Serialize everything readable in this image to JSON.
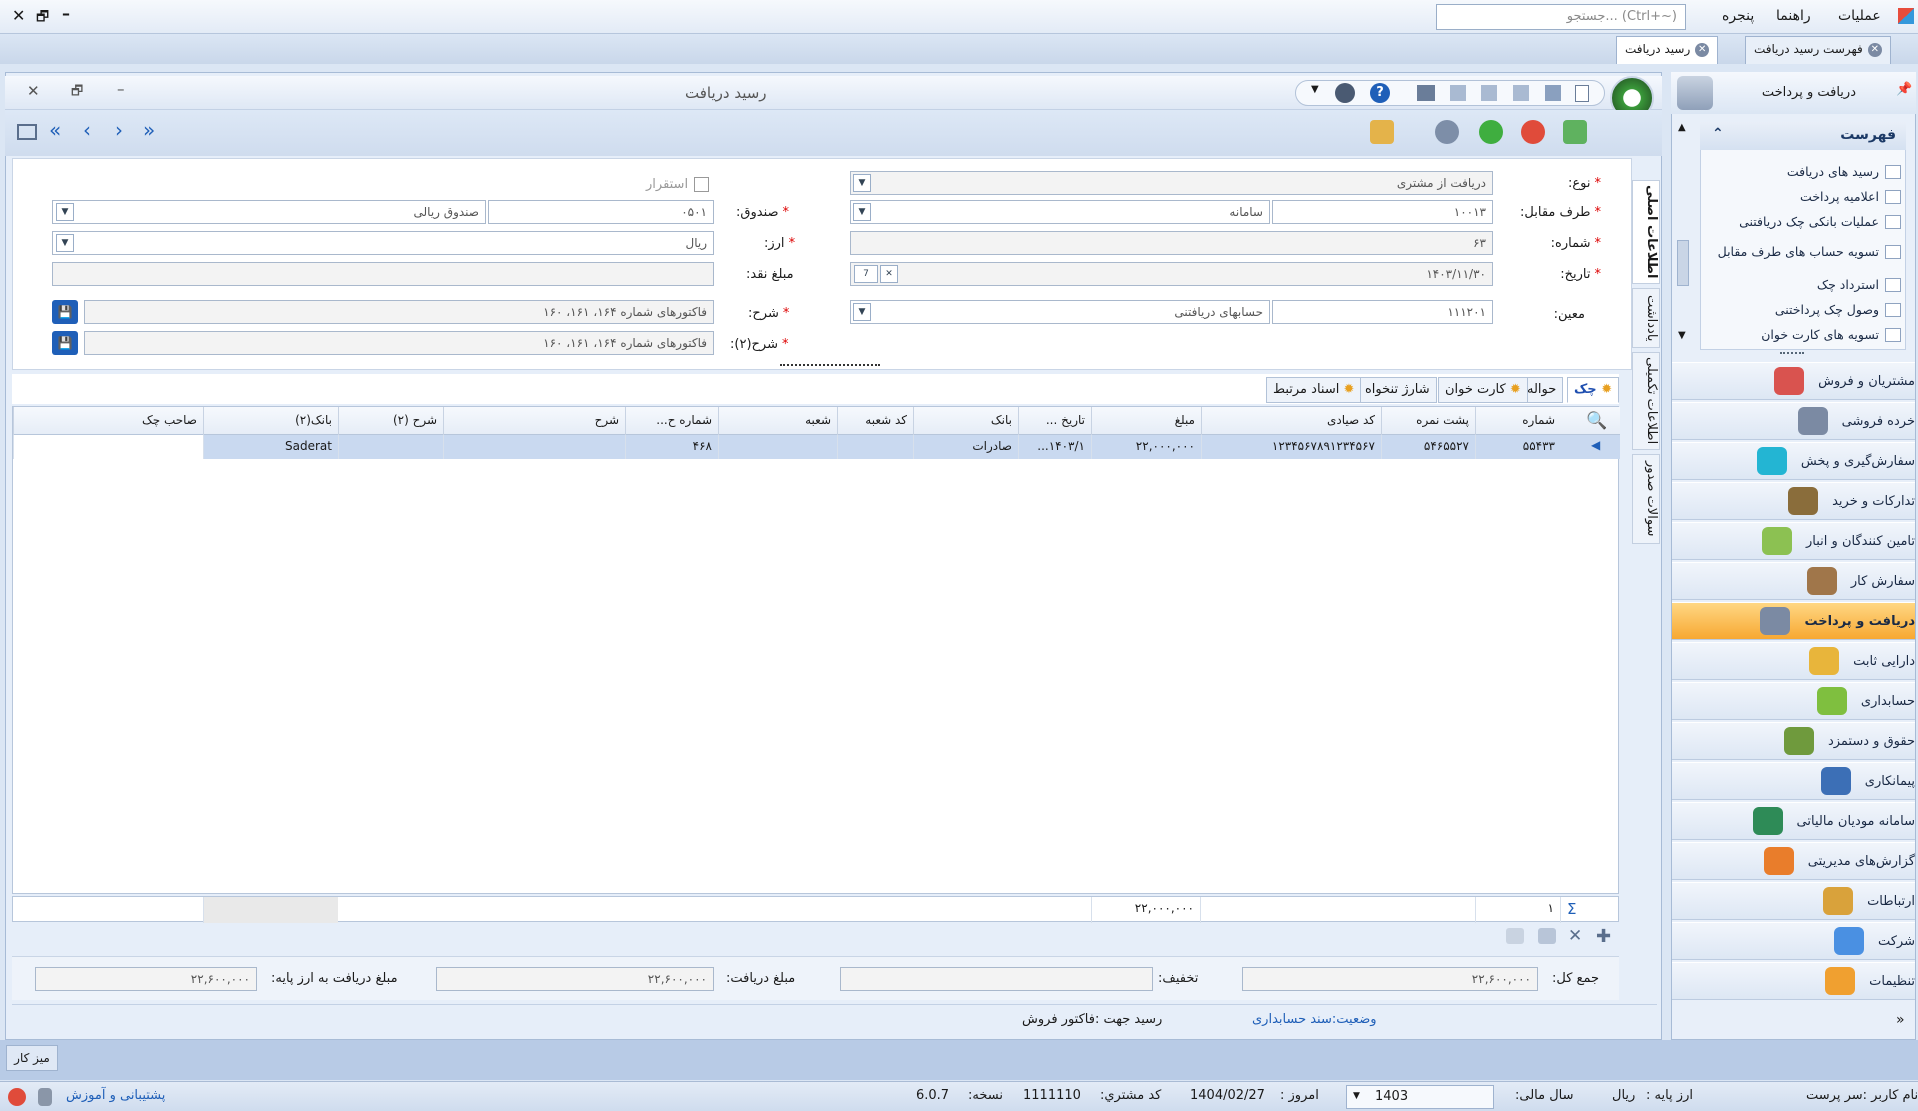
{
  "menu": {
    "ops": "عملیات",
    "help": "راهنما",
    "window": "پنجره",
    "search_placeholder": "جستجو... (Ctrl+~)"
  },
  "doc_tabs": {
    "tab1": "فهرست رسید دریافت",
    "tab2": "رسید دریافت"
  },
  "window": {
    "title": "رسید دریافت"
  },
  "form": {
    "type_label": "نوع:",
    "type_value": "دریافت از مشتری",
    "party_label": "طرف مقابل:",
    "party_code": "۱۰۰۱۳",
    "party_name": "سامانه",
    "number_label": "شماره:",
    "number_value": "۶۳",
    "date_label": "تاریخ:",
    "date_value": "۱۴۰۳/۱۱/۳۰",
    "moein_label": "معین:",
    "moein_code": "۱۱۱۲۰۱",
    "moein_name": "حسابهای دریافتنی",
    "settle_label": "استقرار",
    "cash_label": "صندوق:",
    "cash_code": "۰۵۰۱",
    "cash_name": "صندوق ریالی",
    "currency_label": "ارز:",
    "currency_value": "ریال",
    "cash_amount_label": "مبلغ نقد:",
    "cash_amount_value": "",
    "desc_label": "شرح:",
    "desc_value": "فاکتورهای شماره ۱۶۴، ۱۶۱، ۱۶۰",
    "desc2_label": "شرح(۲):",
    "desc2_value": "فاکتورهای شماره ۱۶۴، ۱۶۱، ۱۶۰"
  },
  "side_tabs": {
    "main": "اطلاعات اصلی",
    "notes": "یادداشت",
    "extra": "اطلاعات تکمیلی",
    "cheque_q": "سوالات صدور"
  },
  "sub_tabs": {
    "cheque": "چک",
    "transfer": "حواله",
    "card": "کارت خوان",
    "charge": "شارژ تنخواه",
    "docs": "اسناد مرتبط"
  },
  "grid": {
    "headers": {
      "number": "شماره",
      "back_no": "پشت نمره",
      "sayad": "کد صیادی",
      "amount": "مبلغ",
      "date": "تاریخ ...",
      "bank": "بانک",
      "branch_code": "کد شعبه",
      "branch": "شعبه",
      "account_no": "شماره ح...",
      "desc": "شرح",
      "desc2": "شرح (۲)",
      "bank2": "بانک(۲)",
      "owner": "صاحب چک"
    },
    "row": {
      "number": "۵۵۴۳۳",
      "back_no": "۵۴۶۵۵۲۷",
      "sayad": "۱۲۳۴۵۶۷۸۹۱۲۳۴۵۶۷",
      "amount": "۲۲,۰۰۰,۰۰۰",
      "date": "۱۴۰۳/۱...",
      "bank": "صادرات",
      "branch_code": "",
      "branch": "",
      "account_no": "۴۶۸",
      "desc": "",
      "desc2": "",
      "bank2": "Saderat",
      "owner": ""
    },
    "footer": {
      "count": "۱",
      "amount_sum": "۲۲,۰۰۰,۰۰۰"
    }
  },
  "totals": {
    "total_label": "جمع کل:",
    "total_value": "۲۲,۶۰۰,۰۰۰",
    "discount_label": "تخفیف:",
    "discount_value": "",
    "received_label": "مبلغ دریافت:",
    "received_value": "۲۲,۶۰۰,۰۰۰",
    "base_label": "مبلغ دریافت به ارز پایه:",
    "base_value": "۲۲,۶۰۰,۰۰۰"
  },
  "status_row": {
    "state": "وضعیت:سند حسابداری",
    "purpose": "رسید جهت :فاکتور فروش"
  },
  "right_panel": {
    "title": "دریافت و پرداخت",
    "list_title": "فهرست",
    "list_items": [
      "رسید های دریافت",
      "اعلامیه پرداخت",
      "عملیات بانکی چک دریافتنی",
      "تسویه حساب های طرف مقابل",
      "استرداد چک",
      "وصول چک پرداختنی",
      "تسویه های کارت خوان"
    ],
    "nav": [
      "مشتریان و فروش",
      "خرده فروشی",
      "سفارش‌گیری و پخش",
      "تدارکات و خرید",
      "تامین کنندگان و انبار",
      "سفارش کار",
      "دریافت و پرداخت",
      "دارایی ثابت",
      "حسابداری",
      "حقوق و دستمزد",
      "پیمانکاری",
      "سامانه مودیان مالیاتی",
      "گزارش‌های مدیریتی",
      "ارتباطات",
      "شرکت",
      "تنظیمات"
    ],
    "nav_colors": [
      "#d9534f",
      "#7b8aa3",
      "#23b5d3",
      "#8a6d3b",
      "#8cc152",
      "#a0764a",
      "#7b8aa3",
      "#e8b53b",
      "#7fbf3f",
      "#6f9a3d",
      "#3c6fb6",
      "#2e8b57",
      "#e97d2b",
      "#d9a23b",
      "#4a90e2",
      "#f0a030"
    ]
  },
  "desk": {
    "button": "میز کار"
  },
  "status": {
    "user": "نام کاربر :سر پرست",
    "base_currency": "ارز پایه :",
    "base_currency_val": "ریال",
    "fiscal_year": "سال مالی:",
    "fiscal_year_val": "1403",
    "today": "امروز :",
    "today_val": "1404/02/27",
    "customer": "کد مشتري:",
    "customer_val": "1111110",
    "version": "نسخه:",
    "version_val": "6.0.7",
    "support": "پشتیبانی و آموزش"
  }
}
